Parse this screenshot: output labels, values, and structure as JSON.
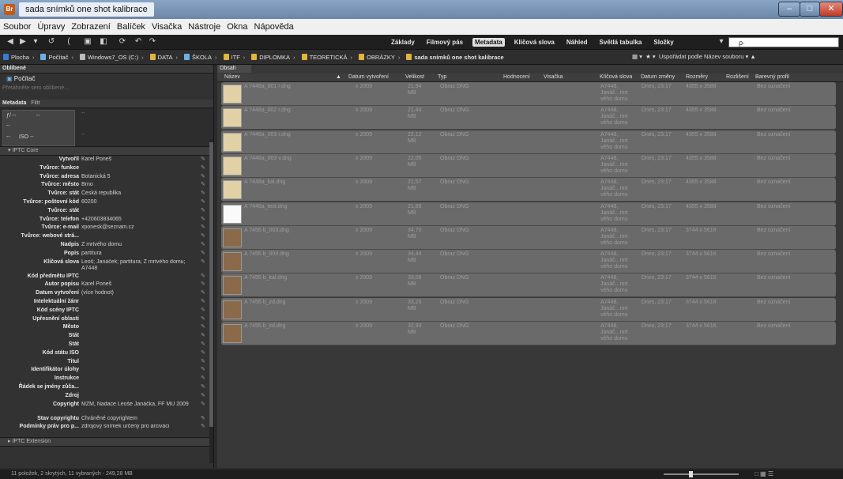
{
  "window": {
    "app_badge": "Br",
    "title": "sada snímků one shot kalibrace",
    "minimize": "–",
    "maximize": "□",
    "close": "✕"
  },
  "menu": [
    "Soubor",
    "Úpravy",
    "Zobrazení",
    "Balíček",
    "Visačka",
    "Nástroje",
    "Okna",
    "Nápověda"
  ],
  "toolbar": {
    "icons": [
      "back-arrow-icon",
      "forward-arrow-icon",
      "dropdown-icon",
      "recent-icon",
      "return-icon",
      "camera-icon",
      "refine-icon",
      "rotate-icon",
      "undo-icon",
      "redo-icon"
    ],
    "workspaces": [
      "Základy",
      "Filmový pás",
      "Metadata",
      "Klíčová slova",
      "Náhled",
      "Světlá tabulka",
      "Složky"
    ],
    "active_workspace": "Metadata",
    "search_placeholder": "ρ·"
  },
  "path": [
    "Plocha",
    "Počítač",
    "Windows7_OS (C:)",
    "DATA",
    "ŠKOLA",
    "ITF",
    "DIPLOMKA",
    "TEORETICKÁ",
    "OBRÁZKY",
    "sada snímků one shot kalibrace"
  ],
  "sort_label": "Uspořádat podle Název souboru",
  "left": {
    "favorites_tab": "Oblíbené",
    "favorites": [
      "Počítač"
    ],
    "favorites_hint": "Přetáhněte sem oblíbené...",
    "meta_tabs": [
      "Metadata",
      "Filtr"
    ],
    "exposure": [
      "ƒ/ --",
      "--",
      "--",
      "--",
      "--",
      "ISO --",
      "--"
    ],
    "iptc_core": "IPTC Core",
    "iptc_extension": "IPTC Extension",
    "fields": [
      {
        "label": "Vytvořil",
        "value": "Karel Poneš"
      },
      {
        "label": "Tvůrce: funkce",
        "value": ""
      },
      {
        "label": "Tvůrce: adresa",
        "value": "Botanická 5"
      },
      {
        "label": "Tvůrce: město",
        "value": "Brno"
      },
      {
        "label": "Tvůrce: stát",
        "value": "Česká republika"
      },
      {
        "label": "Tvůrce: poštovní kód",
        "value": "60200"
      },
      {
        "label": "Tvůrce: stát",
        "value": ""
      },
      {
        "label": "Tvůrce: telefon",
        "value": "+420603834065"
      },
      {
        "label": "Tvůrce: e-mail",
        "value": "xponesk@seznam.cz"
      },
      {
        "label": "Tvůrce: webové strá...",
        "value": ""
      },
      {
        "label": "Nadpis",
        "value": "Z mrtvého domu"
      },
      {
        "label": "Popis",
        "value": "partitura"
      },
      {
        "label": "Klíčová slova",
        "value": "Leoš; Janáček; partitura; Z mrtvého domu; A7448"
      },
      {
        "label": "Kód předmětu IPTC",
        "value": ""
      },
      {
        "label": "Autor popisu",
        "value": "Karel Poneš"
      },
      {
        "label": "Datum vytvoření",
        "value": "(více hodnot)"
      },
      {
        "label": "Intelektuální žánr",
        "value": ""
      },
      {
        "label": "Kód scény IPTC",
        "value": ""
      },
      {
        "label": "Upřesnění oblasti",
        "value": ""
      },
      {
        "label": "Město",
        "value": ""
      },
      {
        "label": "Stát",
        "value": ""
      },
      {
        "label": "Stát",
        "value": ""
      },
      {
        "label": "Kód státu ISO",
        "value": ""
      },
      {
        "label": "Titul",
        "value": ""
      },
      {
        "label": "Identifikátor úlohy",
        "value": ""
      },
      {
        "label": "Instrukce",
        "value": ""
      },
      {
        "label": "Řádek se jmény zůča...",
        "value": ""
      },
      {
        "label": "Zdroj",
        "value": ""
      },
      {
        "label": "Copyright",
        "value": "MZM, Nadace Leoše Janáčka, FF MU 2009"
      },
      {
        "label": "Stav copyrightu",
        "value": "Chráněné copyrightem"
      },
      {
        "label": "Podmínky práv pro p...",
        "value": "zdrojový snímek určený pro arcivaci"
      }
    ]
  },
  "content": {
    "tab": "Obsah",
    "columns": [
      "Název",
      "Datum vytvoření",
      "Velikost",
      "Typ",
      "Hodnocení",
      "Visačka",
      "Klíčová slova",
      "Datum změny",
      "Rozměry",
      "Rozlišení",
      "Barevný profil"
    ],
    "rows": [
      {
        "name": "A 7448a_001 r.dng",
        "date": "x 2009",
        "size": "21,94 MB",
        "type": "Obraz DNG",
        "keywords": "A7448, Janáč...mrt vého domu",
        "modified": "Dnes, 23:17",
        "dims": "4355 x 3588",
        "profile": "Bez označení",
        "thumb": "paper"
      },
      {
        "name": "A 7448a_002 r.dng",
        "date": "x 2009",
        "size": "21,44 MB",
        "type": "Obraz DNG",
        "keywords": "A7448, Janáč...mrt vého domu",
        "modified": "Dnes, 23:17",
        "dims": "4355 x 3588",
        "profile": "Bez označení",
        "thumb": "paper"
      },
      {
        "name": "A 7448a_003 r.dng",
        "date": "x 2009",
        "size": "22,12 MB",
        "type": "Obraz DNG",
        "keywords": "A7448, Janáč...mrt vého domu",
        "modified": "Dnes, 23:17",
        "dims": "4355 x 3588",
        "profile": "Bez označení",
        "thumb": "paper"
      },
      {
        "name": "A 7448a_003 v.dng",
        "date": "x 2009",
        "size": "22,05 MB",
        "type": "Obraz DNG",
        "keywords": "A7448, Janáč...mrt vého domu",
        "modified": "Dnes, 23:17",
        "dims": "4355 x 3588",
        "profile": "Bez označení",
        "thumb": "paper"
      },
      {
        "name": "A 7448a_kal.dng",
        "date": "x 2009",
        "size": "21,57 MB",
        "type": "Obraz DNG",
        "keywords": "A7448, Janáč...mrt vého domu",
        "modified": "Dnes, 23:17",
        "dims": "4355 x 3588",
        "profile": "Bez označení",
        "thumb": "paper"
      },
      {
        "name": "A 7448a_test.dng",
        "date": "x 2009",
        "size": "21,86 MB",
        "type": "Obraz DNG",
        "keywords": "A7448, Janáč...mrt vého domu",
        "modified": "Dnes, 23:17",
        "dims": "4355 x 3588",
        "profile": "Bez označení",
        "thumb": "white"
      },
      {
        "name": "A 7455 b_003.dng",
        "date": "x 2009",
        "size": "34,70 MB",
        "type": "Obraz DNG",
        "keywords": "A7448, Janáč...mrt vého domu",
        "modified": "Dnes, 23:17",
        "dims": "3744 x 5616",
        "profile": "Bez označení",
        "thumb": "dark"
      },
      {
        "name": "A 7455 b_004.dng",
        "date": "x 2009",
        "size": "34,44 MB",
        "type": "Obraz DNG",
        "keywords": "A7448, Janáč...mrt vého domu",
        "modified": "Dnes, 23:17",
        "dims": "3744 x 5616",
        "profile": "Bez označení",
        "thumb": "dark"
      },
      {
        "name": "A 7455 b_kal.dng",
        "date": "x 2009",
        "size": "33,08 MB",
        "type": "Obraz DNG",
        "keywords": "A7448, Janáč...mrt vého domu",
        "modified": "Dnes, 23:17",
        "dims": "3744 x 5616",
        "profile": "Bez označení",
        "thumb": "dark"
      },
      {
        "name": "A 7455 b_zd.dng",
        "date": "x 2009",
        "size": "33,26 MB",
        "type": "Obraz DNG",
        "keywords": "A7448, Janáč...mrt vého domu",
        "modified": "Dnes, 23:17",
        "dims": "3744 x 5616",
        "profile": "Bez označení",
        "thumb": "dark"
      },
      {
        "name": "A 7455 b_zd.dng",
        "date": "x 2009",
        "size": "32,93 MB",
        "type": "Obraz DNG",
        "keywords": "A7448, Janáč...mrt vého domu",
        "modified": "Dnes, 23:17",
        "dims": "3744 x 5616",
        "profile": "Bez označení",
        "thumb": "dark"
      }
    ]
  },
  "status": "11 položek, 2 skrytých, 11 vybraných - 249,28 MB",
  "colors": {
    "accent": "#c25b16",
    "folder": "#e2b43a",
    "row": "#6a6a6a"
  }
}
